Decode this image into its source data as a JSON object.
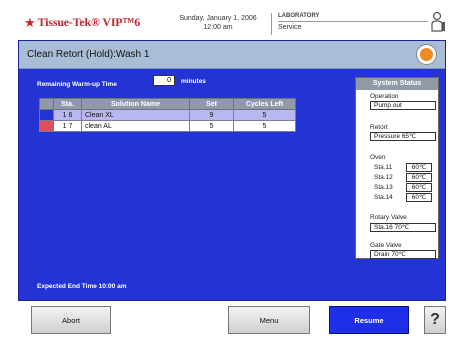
{
  "header": {
    "brand": "Tissue-Tek® VIP™6",
    "date": "Sunday, January 1, 2006",
    "time": "12:00 am",
    "department": "LABORATORY",
    "user": "Service"
  },
  "panel": {
    "title": "Clean Retort (Hold):Wash 1",
    "warmup_label": "Remaining Warm-up Time",
    "warmup_value": "0",
    "warmup_unit": "minutes",
    "expected_end_label": "Expected End Time",
    "expected_end_value": "10:00 am"
  },
  "table": {
    "headers": [
      "Sta.",
      "Solution Name",
      "Set",
      "Cycles Left"
    ],
    "rows": [
      {
        "sta": "1 6",
        "name": "Clean XL",
        "set": "9",
        "cycles": "5"
      },
      {
        "sta": "1 7",
        "name": "clean AL",
        "set": "5",
        "cycles": "5"
      }
    ]
  },
  "system_status": {
    "title": "System Status",
    "operation_label": "Operation",
    "operation_value": "Pump out",
    "retort_label": "Retort",
    "retort_value": "Pressure 65℃",
    "oven_label": "Oven",
    "oven": [
      {
        "label": "Sta.11",
        "value": "60℃"
      },
      {
        "label": "Sta.12",
        "value": "60℃"
      },
      {
        "label": "Sta.13",
        "value": "60℃"
      },
      {
        "label": "Sta.14",
        "value": "60℃"
      }
    ],
    "rotary_label": "Rotary Valve",
    "rotary_value": "Sta.16 70℃",
    "gate_label": "Gate Valve",
    "gate_value": "Drain 70℃"
  },
  "buttons": {
    "abort": "Abort",
    "menu": "Menu",
    "resume": "Resume",
    "help": "?"
  },
  "colors": {
    "panel_blue": "#2434d4",
    "resume_blue": "#1f2fe8",
    "brand_red": "#c0282f",
    "selected_row": "#b9b7ef",
    "status_marker": "#e0505a",
    "help_orange": "#f08a24"
  },
  "icons": {
    "logo": "star-icon",
    "user": "user-icon",
    "panel_help": "help-circle-icon"
  }
}
